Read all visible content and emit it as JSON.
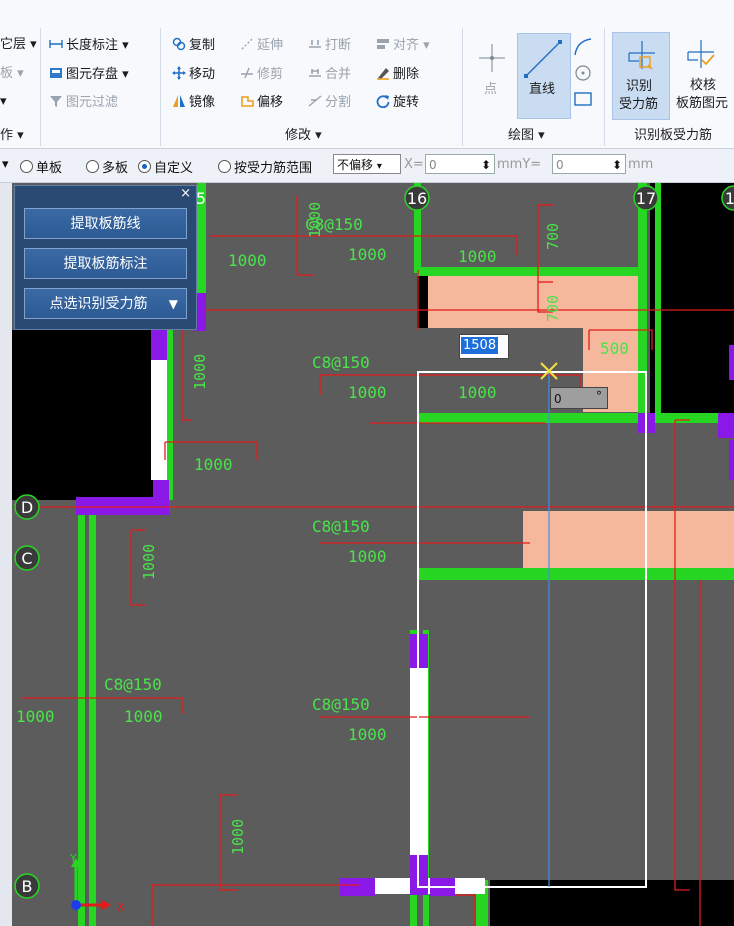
{
  "ribbon": {
    "col1": {
      "layer": "它层",
      "board": "板",
      "op": "作"
    },
    "dims": {
      "length_dim": "长度标注",
      "save_elem": "图元存盘",
      "filter": "图元过滤"
    },
    "modify": {
      "copy": "复制",
      "extend": "延伸",
      "break": "打断",
      "align": "对齐",
      "move": "移动",
      "trim": "修剪",
      "merge": "合并",
      "delete": "删除",
      "mirror": "镜像",
      "offset": "偏移",
      "split": "分割",
      "rotate": "旋转",
      "group": "修改"
    },
    "draw": {
      "point": "点",
      "line": "直线",
      "group": "绘图"
    },
    "recognize": {
      "identify1": "识别",
      "identify2": "受力筋",
      "check1": "校核",
      "check2": "板筋图元",
      "group": "识别板受力筋"
    }
  },
  "optbar": {
    "single": "单板",
    "multi": "多板",
    "custom": "自定义",
    "range": "按受力筋范围",
    "offset": "不偏移",
    "x_label": "X=",
    "x_value": "0",
    "mm_y": "mmY=",
    "y_value": "0",
    "mm": "mm"
  },
  "panel": {
    "btn1": "提取板筋线",
    "btn2": "提取板筋标注",
    "btn3": "点选识别受力筋",
    "close": "×"
  },
  "cad": {
    "axis_15": "5",
    "axis_16": "16",
    "axis_17": "17",
    "axis_18": "1",
    "axis_d": "D",
    "axis_c": "C",
    "axis_b": "B",
    "spec": "C8@150",
    "d1000": "1000",
    "d700": "700",
    "d500": "500",
    "input_value": "1508",
    "angle_value": "0",
    "degree": "°",
    "x_axis": "X",
    "y_axis": "Y"
  },
  "colors": {
    "wall_green": "#27d623",
    "purple": "#8a18e6",
    "red_line": "#e41b1b",
    "salmon": "#f5b89c",
    "canvas_gray": "#5c5c5c"
  }
}
